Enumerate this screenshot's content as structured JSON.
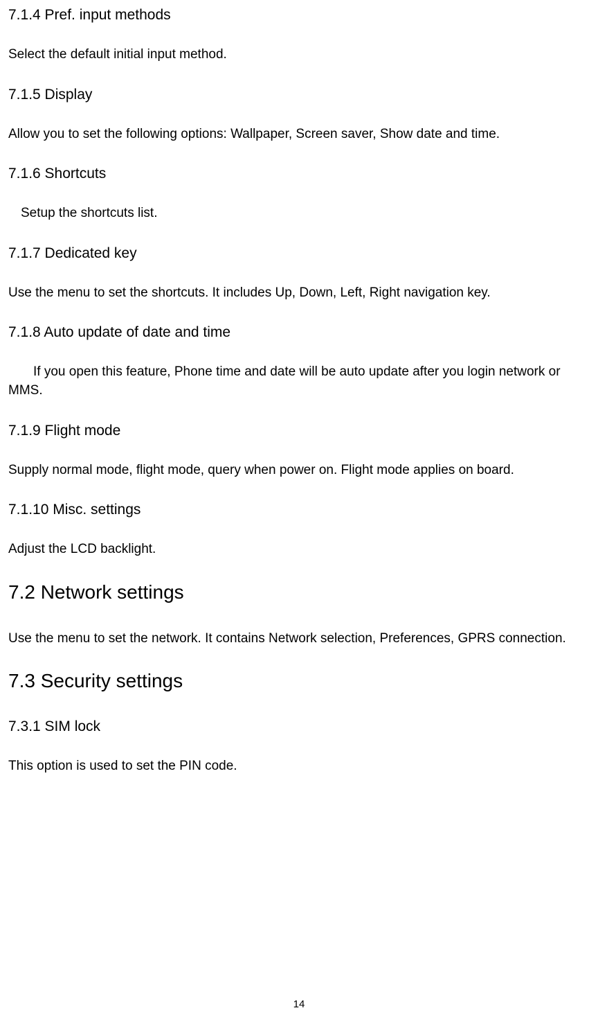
{
  "sections": {
    "s1": {
      "heading": "7.1.4 Pref. input methods",
      "body": "Select the default initial input method."
    },
    "s2": {
      "heading": "7.1.5 Display",
      "body": "Allow you to set the following options: Wallpaper, Screen saver, Show date and time."
    },
    "s3": {
      "heading": "7.1.6 Shortcuts",
      "body": "Setup the shortcuts list."
    },
    "s4": {
      "heading": "7.1.7 Dedicated key",
      "body": "Use the menu to set the shortcuts. It includes Up, Down, Left, Right navigation key."
    },
    "s5": {
      "heading": "7.1.8 Auto update of date and time",
      "body": "If you open this feature, Phone time and date will be auto update after you login network or MMS."
    },
    "s6": {
      "heading": "7.1.9 Flight mode",
      "body": "Supply normal mode, flight mode, query when power on. Flight mode applies on board."
    },
    "s7": {
      "heading": "7.1.10 Misc. settings",
      "body": "Adjust the LCD backlight."
    },
    "s8": {
      "heading": "7.2 Network settings",
      "body": "Use the menu to set the network. It contains Network selection, Preferences, GPRS connection."
    },
    "s9": {
      "heading": "7.3 Security settings"
    },
    "s10": {
      "heading": "7.3.1 SIM lock",
      "body": "This option is used to set the PIN code."
    }
  },
  "page_number": "14"
}
